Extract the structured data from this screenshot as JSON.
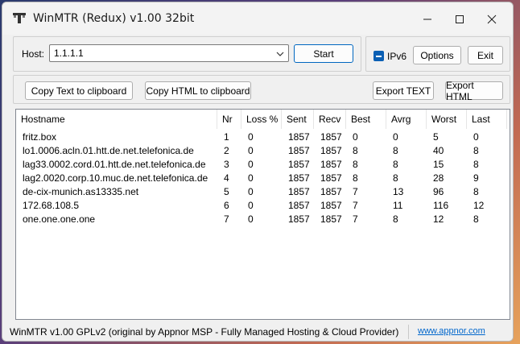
{
  "window": {
    "title": "WinMTR (Redux) v1.00 32bit"
  },
  "host": {
    "label": "Host:",
    "value": "1.1.1.1"
  },
  "buttons": {
    "start": "Start",
    "options": "Options",
    "exit": "Exit",
    "copy_text": "Copy Text to clipboard",
    "copy_html": "Copy HTML to clipboard",
    "export_text": "Export TEXT",
    "export_html": "Export HTML"
  },
  "ipv6": {
    "label": "IPv6",
    "checked": true
  },
  "table": {
    "headers": [
      "Hostname",
      "Nr",
      "Loss %",
      "Sent",
      "Recv",
      "Best",
      "Avrg",
      "Worst",
      "Last"
    ],
    "rows": [
      [
        "fritz.box",
        "1",
        "0",
        "1857",
        "1857",
        "0",
        "0",
        "5",
        "0"
      ],
      [
        "lo1.0006.acln.01.htt.de.net.telefonica.de",
        "2",
        "0",
        "1857",
        "1857",
        "8",
        "8",
        "40",
        "8"
      ],
      [
        "lag33.0002.cord.01.htt.de.net.telefonica.de",
        "3",
        "0",
        "1857",
        "1857",
        "8",
        "8",
        "15",
        "8"
      ],
      [
        "lag2.0020.corp.10.muc.de.net.telefonica.de",
        "4",
        "0",
        "1857",
        "1857",
        "8",
        "8",
        "28",
        "9"
      ],
      [
        "de-cix-munich.as13335.net",
        "5",
        "0",
        "1857",
        "1857",
        "7",
        "13",
        "96",
        "8"
      ],
      [
        "172.68.108.5",
        "6",
        "0",
        "1857",
        "1857",
        "7",
        "11",
        "116",
        "12"
      ],
      [
        "one.one.one.one",
        "7",
        "0",
        "1857",
        "1857",
        "7",
        "8",
        "12",
        "8"
      ]
    ]
  },
  "status": {
    "text": "WinMTR v1.00 GPLv2 (original by Appnor MSP - Fully Managed Hosting & Cloud Provider)",
    "link": "www.appnor.com"
  },
  "colors": {
    "accent": "#0067c0",
    "checkbox": "#0a5fb4",
    "link": "#0066cc"
  }
}
